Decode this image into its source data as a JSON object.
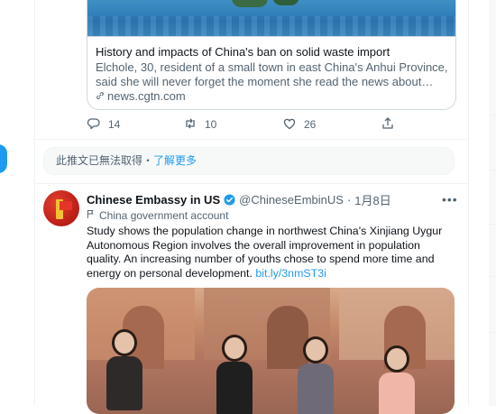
{
  "prev_tweet": {
    "card": {
      "title": "History and impacts of China's ban on solid waste import",
      "description": "Elchole, 30, resident of a small town in east China's Anhui Province, said she will never forget the moment she read the news about China puttin…",
      "domain": "news.cgtn.com"
    },
    "actions": {
      "replies": "14",
      "retweets": "10",
      "likes": "26"
    }
  },
  "unavailable": {
    "text": "此推文已無法取得",
    "separator": "・",
    "link": "了解更多"
  },
  "tweet": {
    "name": "Chinese Embassy in US",
    "handle": "@ChineseEmbinUS",
    "separator": "·",
    "date": "1月8日",
    "label": "China government account",
    "text": "Study shows the population change in northwest China's Xinjiang Uygur Autonomous Region involves the overall improvement in population quality. An increasing number of youths chose to spend more time and energy on personal development. ",
    "url": "bit.ly/3nmST3i"
  },
  "icons": {
    "reply": "reply-icon",
    "retweet": "retweet-icon",
    "like": "heart-icon",
    "share": "share-icon",
    "verified": "verified-badge-icon",
    "more": "more-icon",
    "flag": "flag-icon",
    "link": "link-icon"
  },
  "colors": {
    "accent": "#1d9bf0",
    "secondary_text": "#536471",
    "primary_text": "#0f1419"
  }
}
